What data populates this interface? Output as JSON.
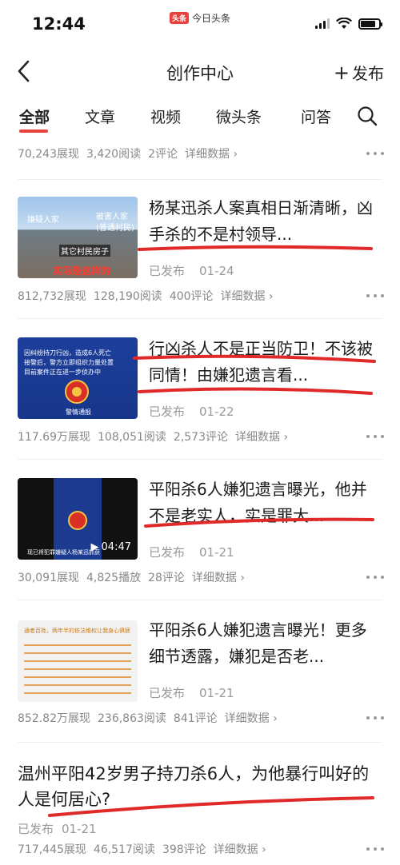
{
  "status_bar": {
    "time": "12:44",
    "app_badge": "头条",
    "app_name": "今日头条"
  },
  "nav": {
    "title": "创作中心",
    "publish_label": "发布"
  },
  "tabs": [
    "全部",
    "文章",
    "视频",
    "微头条",
    "问答"
  ],
  "top_stats": {
    "views": "70,243展现",
    "reads": "3,420阅读",
    "comments": "2评论",
    "detail": "详细数据 ›"
  },
  "articles": [
    {
      "title": "杨某迅杀人案真相日渐清晰，凶手杀的不是村领导...",
      "status": "已发布",
      "date": "01-24",
      "views": "812,732展现",
      "reads": "128,190阅读",
      "comments": "400评论",
      "detail": "详细数据 ›",
      "thumb_texts": [
        "嫌疑人家",
        "被害人家",
        "(普通村民)",
        "其它村民房子",
        "实际是这样的"
      ]
    },
    {
      "title": "行凶杀人不是正当防卫！不该被同情！由嫌犯遗言看...",
      "status": "已发布",
      "date": "01-22",
      "views": "117.69万展现",
      "reads": "108,051阅读",
      "comments": "2,573评论",
      "detail": "详细数据 ›",
      "thumb_texts": [
        "因纠纷持刀行凶，造成6人死亡",
        "接警后，警方立即组织力量处置",
        "目前案件正在进一步侦办中",
        "警情通报"
      ]
    },
    {
      "title": "平阳杀6人嫌犯遗言曝光，他并不是老实人，实是罪大...",
      "status": "已发布",
      "date": "01-21",
      "views": "30,091展现",
      "reads": "4,825播放",
      "comments": "28评论",
      "detail": "详细数据 ›",
      "duration": "04:47",
      "thumb_texts": [
        "现已将犯罪嫌疑人杨某迅抓获"
      ]
    },
    {
      "title": "平阳杀6人嫌犯遗言曝光！更多细节透露，嫌犯是否老...",
      "status": "已发布",
      "date": "01-21",
      "views": "852.82万展现",
      "reads": "236,863阅读",
      "comments": "841评论",
      "detail": "详细数据 ›",
      "thumb_texts": [
        "通者百姓，两年半的依法维权让我身心俱疲"
      ]
    },
    {
      "title": "温州平阳42岁男子持刀杀6人，为他暴行叫好的人是何居心?",
      "status": "已发布",
      "date": "01-21",
      "views": "717,445展现",
      "reads": "46,517阅读",
      "comments": "398评论",
      "detail": "详细数据 ›"
    }
  ],
  "colors": {
    "accent": "#e8403a",
    "text": "#1a1a1a",
    "muted": "#888888"
  }
}
